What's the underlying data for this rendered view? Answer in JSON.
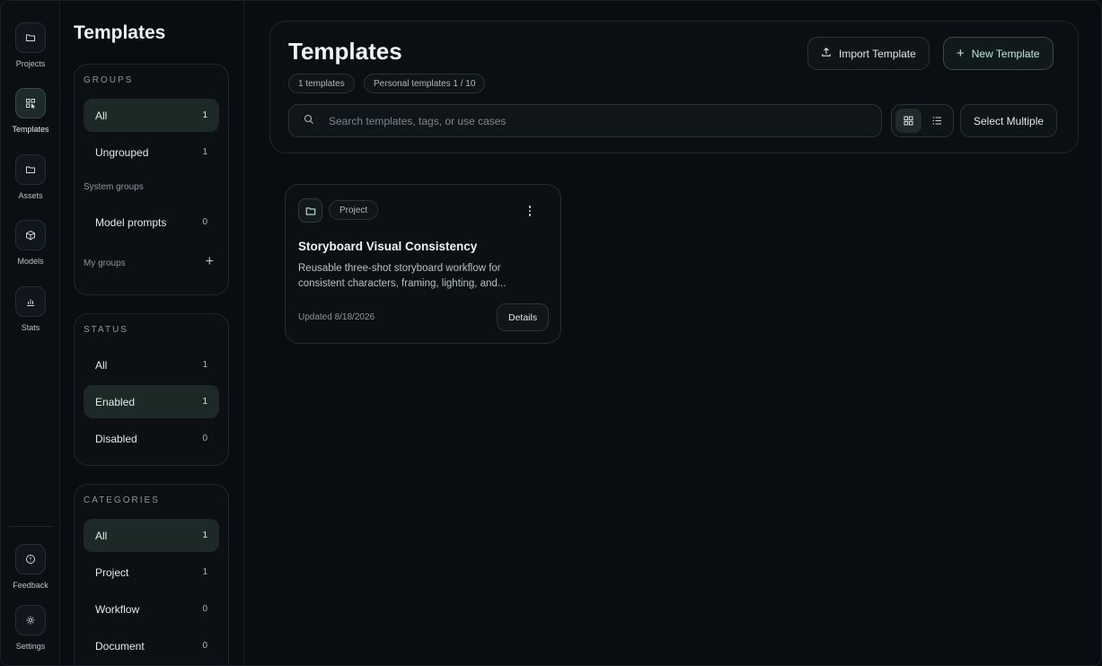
{
  "rail": {
    "projects": "Projects",
    "templates": "Templates",
    "assets": "Assets",
    "models": "Models",
    "stats": "Stats",
    "feedback": "Feedback",
    "settings": "Settings"
  },
  "panel": {
    "title": "Templates",
    "groups": {
      "heading": "GROUPS",
      "all": {
        "label": "All",
        "count": "1"
      },
      "ungrouped": {
        "label": "Ungrouped",
        "count": "1"
      },
      "system_heading": "System groups",
      "model_prompts": {
        "label": "Model prompts",
        "count": "0"
      },
      "my_groups_heading": "My groups",
      "add": "+"
    },
    "status": {
      "heading": "STATUS",
      "all": {
        "label": "All",
        "count": "1"
      },
      "enabled": {
        "label": "Enabled",
        "count": "1"
      },
      "disabled": {
        "label": "Disabled",
        "count": "0"
      }
    },
    "categories": {
      "heading": "CATEGORIES",
      "all": {
        "label": "All",
        "count": "1"
      },
      "project": {
        "label": "Project",
        "count": "1"
      },
      "workflow": {
        "label": "Workflow",
        "count": "0"
      },
      "document": {
        "label": "Document",
        "count": "0"
      }
    }
  },
  "header": {
    "title": "Templates",
    "chip_count": "1 templates",
    "chip_personal": "Personal templates 1 / 10",
    "import_label": "Import Template",
    "new_label": "New Template",
    "search_placeholder": "Search templates, tags, or use cases",
    "select_multiple": "Select Multiple"
  },
  "template_card": {
    "category": "Project",
    "title": "Storyboard Visual Consistency",
    "description": "Reusable three-shot storyboard workflow for consistent characters, framing, lighting, and...",
    "updated": "Updated 8/18/2026",
    "details_label": "Details"
  },
  "colors": {
    "background": "#090c11",
    "accent": "#bfe7dd",
    "selected": "#1c2926"
  }
}
